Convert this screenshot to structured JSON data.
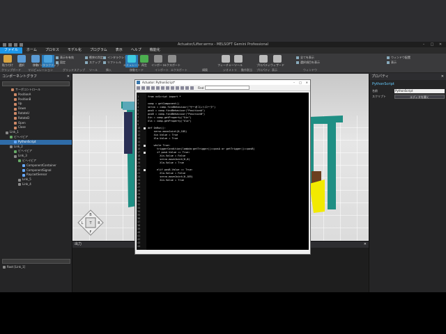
{
  "window": {
    "title": "Actuator/Lifter.wrmx - MELSOFT Gemini Professional"
  },
  "menu": [
    "ファイル",
    "ホーム",
    "プロセス",
    "モデル化",
    "プログラム",
    "表示",
    "ヘルプ",
    "機能化"
  ],
  "ribbon": {
    "buttons": [
      {
        "label": "貼り付け",
        "color": "#d9a441"
      },
      {
        "label": "選択",
        "color": "#5b9bd5"
      },
      {
        "label": "移動",
        "color": "#5b9bd5"
      },
      {
        "label": "インタラクティブ",
        "color": "#4aa3df"
      },
      {
        "label": "エミュレート",
        "color": "#3ecbe0"
      },
      {
        "label": "再生",
        "color": "#4caf50"
      },
      {
        "label": "インポート",
        "color": "#8e8e8e"
      },
      {
        "label": "エクスポート",
        "color": "#8e8e8e"
      },
      {
        "label": "フィーチャー",
        "color": "#bbbbbb"
      },
      {
        "label": "ツール",
        "color": "#bbbbbb"
      },
      {
        "label": "プロパティ",
        "color": "#bbbbbb"
      },
      {
        "label": "ウィザード",
        "color": "#bbbbbb"
      }
    ],
    "small_items": [
      "表示を有効",
      "固定",
      "衝突の判定",
      "スナップ",
      "インタラクション",
      "リフトレル",
      "全てを表示",
      "選択項目を表示",
      "ウィンドウ配置",
      "表示"
    ],
    "groups": [
      "クリップボード",
      "マニピュレーション",
      "グリッドスナップ",
      "ツール",
      "挿入",
      "移動モード",
      "インポート",
      "エクスポート",
      "構築",
      "ジオメトリ",
      "動作割当",
      "プロパティ",
      "表示",
      "ウィンドウ"
    ]
  },
  "left_panel": {
    "title": "コンポーネントグラフ",
    "tree": [
      {
        "label": "サーボコントロール",
        "color": "#c86"
      },
      {
        "label": "PositionA",
        "color": "#c86"
      },
      {
        "label": "PositionB",
        "color": "#c86"
      },
      {
        "label": "Up",
        "color": "#c86"
      },
      {
        "label": "Down",
        "color": "#c86"
      },
      {
        "label": "RotateU",
        "color": "#c86"
      },
      {
        "label": "RotateD",
        "color": "#c86"
      },
      {
        "label": "Open",
        "color": "#c86"
      },
      {
        "label": "Close",
        "color": "#c86"
      },
      {
        "label": "Link_1",
        "color": "#888"
      },
      {
        "label": "ビヘイビア",
        "color": "#6a6"
      },
      {
        "label": "PythonScript",
        "color": "#6af",
        "selected": true
      },
      {
        "label": "Link_2",
        "color": "#888"
      },
      {
        "label": "ビヘイビア",
        "color": "#6a6"
      },
      {
        "label": "Link_3",
        "color": "#888"
      },
      {
        "label": "ビヘイビア",
        "color": "#6a6"
      },
      {
        "label": "ComponentContainer",
        "color": "#6af"
      },
      {
        "label": "ComponentSignal",
        "color": "#6af"
      },
      {
        "label": "RaycastSensor",
        "color": "#6af"
      },
      {
        "label": "Link_5",
        "color": "#888"
      },
      {
        "label": "Link_4",
        "color": "#888"
      }
    ],
    "tree2_title": "Root [Link_1]"
  },
  "right_panel": {
    "title": "プロパティ",
    "section": "PythonScript",
    "rows": [
      {
        "label": "名前",
        "value": "PythonScript"
      },
      {
        "label": "スクリプト",
        "button": "エディタを開く"
      }
    ]
  },
  "output": {
    "title": "出力"
  },
  "python_window": {
    "title": "Actuator::PythonScript*",
    "find_label": "Find",
    "lines": [
      {
        "n": "1",
        "t": "from vcScript import *"
      },
      {
        "n": "2",
        "t": ""
      },
      {
        "n": "3",
        "t": "comp = getComponent()"
      },
      {
        "n": "4",
        "t": "servo = comp.findBehaviour(\"サーボコントローラ\")"
      },
      {
        "n": "5",
        "t": "posA = comp.findBehaviour(\"PositionA\")"
      },
      {
        "n": "6",
        "t": "posB = comp.findBehaviour(\"PositionB\")"
      },
      {
        "n": "7",
        "t": "Xin = comp.getProperty(\"Xin\")"
      },
      {
        "n": "8",
        "t": "Xla = comp.getProperty(\"Xla\")"
      },
      {
        "n": "9",
        "t": ""
      },
      {
        "n": "10",
        "t": "def OnRun():"
      },
      {
        "n": "11",
        "t": "    servo.moveJoint(0,185)"
      },
      {
        "n": "12",
        "t": "    Xin.Value = True"
      },
      {
        "n": "13",
        "t": "    Xla.Value = True"
      },
      {
        "n": "14",
        "t": ""
      },
      {
        "n": "15",
        "t": "    while True:"
      },
      {
        "n": "16",
        "t": "      triggerCondition(lambda:getTrigger()==posA or getTrigger()==posB)"
      },
      {
        "n": "17",
        "t": "      if posA.Value == True:"
      },
      {
        "n": "18",
        "t": "        Xin.Value = False"
      },
      {
        "n": "19",
        "t": "        servo.moveJoint(0,0)"
      },
      {
        "n": "20",
        "t": "        Xla.Value = True"
      },
      {
        "n": "21",
        "t": ""
      },
      {
        "n": "22",
        "t": "      elif posB.Value == True:"
      },
      {
        "n": "23",
        "t": "        Xla.Value = False"
      },
      {
        "n": "24",
        "t": "        servo.moveJoint(0,185)"
      },
      {
        "n": "25",
        "t": "        Xin.Value = True"
      },
      {
        "n": "26",
        "t": ""
      },
      {
        "n": "27",
        "t": ""
      },
      {
        "n": "28",
        "t": ""
      },
      {
        "n": "29",
        "t": ""
      },
      {
        "n": "30",
        "t": ""
      },
      {
        "n": "31",
        "t": ""
      },
      {
        "n": "32",
        "t": ""
      },
      {
        "n": "33",
        "t": ""
      },
      {
        "n": "34",
        "t": ""
      },
      {
        "n": "35",
        "t": ""
      },
      {
        "n": "36",
        "t": ""
      },
      {
        "n": "37",
        "t": ""
      },
      {
        "n": "38",
        "t": ""
      },
      {
        "n": "39",
        "t": ""
      },
      {
        "n": "40",
        "t": ""
      },
      {
        "n": "41",
        "t": ""
      },
      {
        "n": "42",
        "t": ""
      },
      {
        "n": "43",
        "t": ""
      },
      {
        "n": "44",
        "t": ""
      }
    ]
  },
  "navcube": {
    "top": "B",
    "left": "L",
    "center": "T",
    "right": "R",
    "bottom": "F"
  }
}
